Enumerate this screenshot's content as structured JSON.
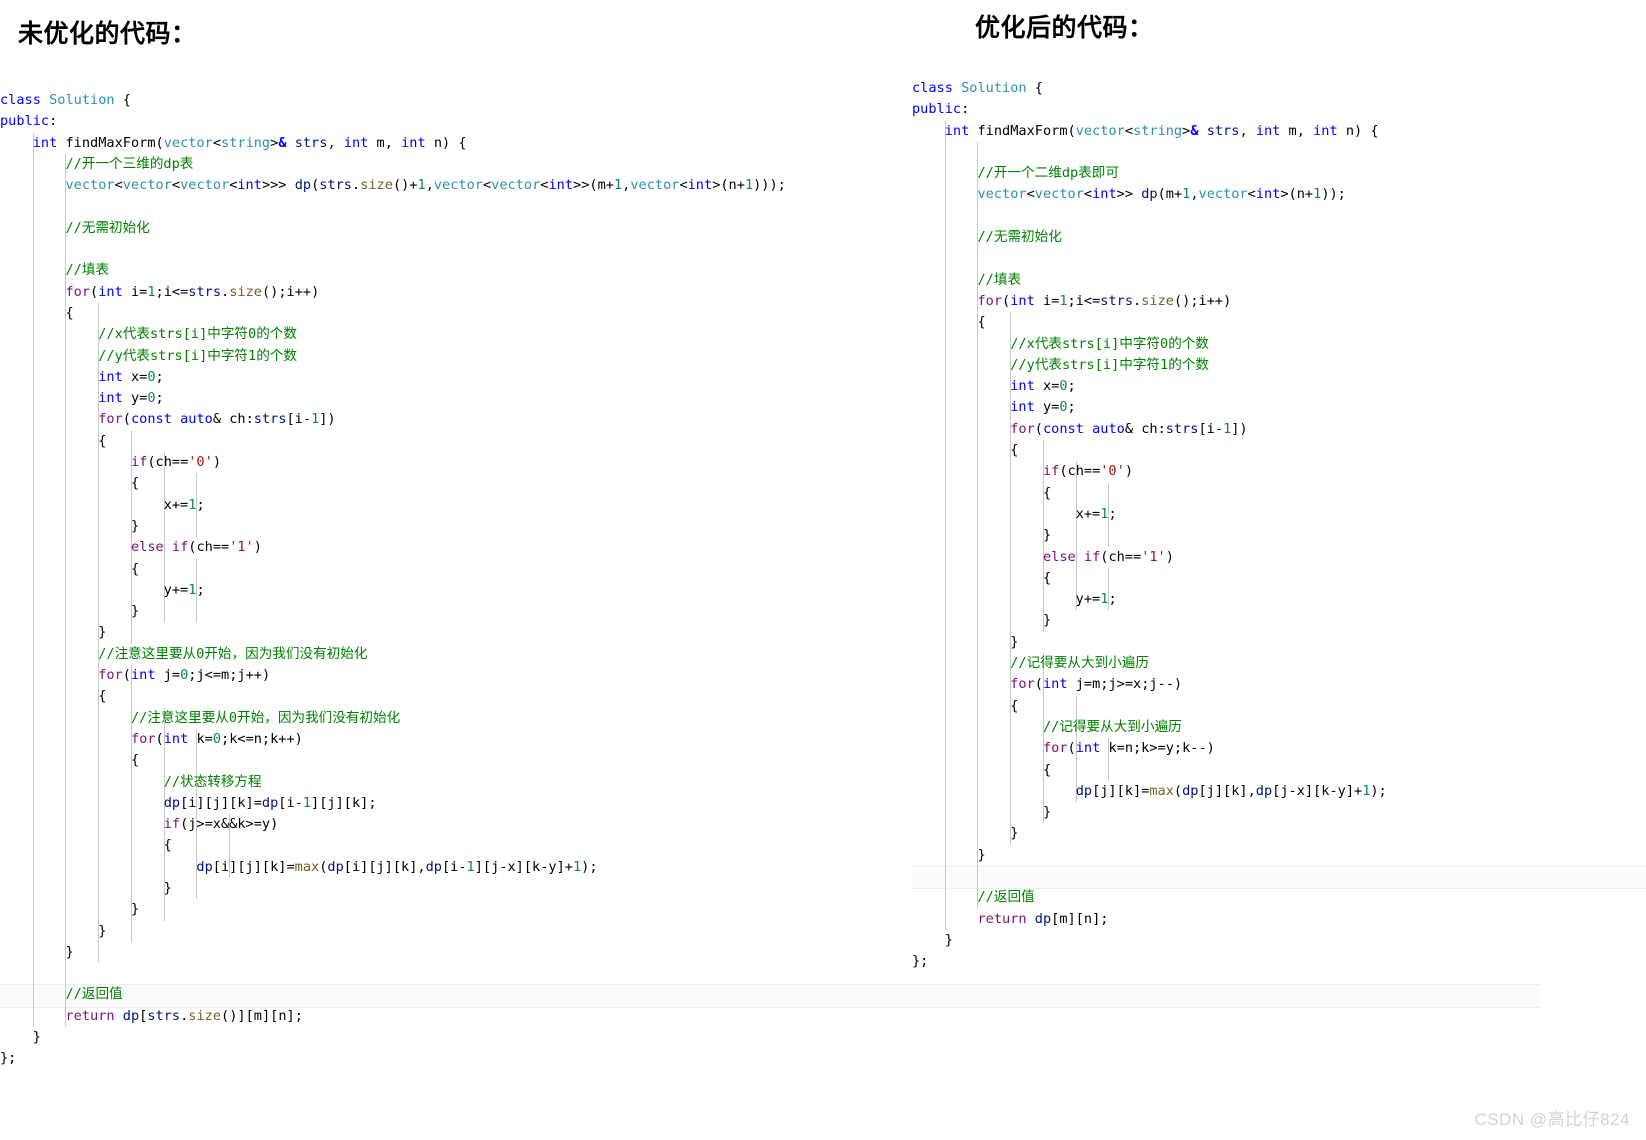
{
  "page": {
    "watermark": "CSDN @高比仔824",
    "background_color": "#ffffff",
    "highlight_band_color": "#fbfbfb"
  },
  "panels": [
    {
      "id": "unoptimized",
      "heading": "未优化的代码：",
      "language": "C++",
      "code_lines": [
        "class Solution {",
        "public:",
        "    int findMaxForm(vector<string>& strs, int m, int n) {",
        "        //开一个三维的dp表",
        "        vector<vector<vector<int>>> dp(strs.size()+1,vector<vector<int>>(m+1,vector<int>(n+1)));",
        "",
        "        //无需初始化",
        "",
        "        //填表",
        "        for(int i=1;i<=strs.size();i++)",
        "        {",
        "            //x代表strs[i]中字符0的个数",
        "            //y代表strs[i]中字符1的个数",
        "            int x=0;",
        "            int y=0;",
        "            for(const auto& ch:strs[i-1])",
        "            {",
        "                if(ch=='0')",
        "                {",
        "                    x+=1;",
        "                }",
        "                else if(ch=='1')",
        "                {",
        "                    y+=1;",
        "                }",
        "            }",
        "            //注意这里要从0开始，因为我们没有初始化",
        "            for(int j=0;j<=m;j++)",
        "            {",
        "                //注意这里要从0开始，因为我们没有初始化",
        "                for(int k=0;k<=n;k++)",
        "                {",
        "                    //状态转移方程",
        "                    dp[i][j][k]=dp[i-1][j][k];",
        "                    if(j>=x&&k>=y)",
        "                    {",
        "                        dp[i][j][k]=max(dp[i][j][k],dp[i-1][j-x][k-y]+1);",
        "                    }",
        "                }",
        "            }",
        "        }",
        "",
        "        //返回值",
        "        return dp[strs.size()][m][n];",
        "    }",
        "};"
      ],
      "highlighted_line_index": 42,
      "highlighted_line_text": "        //返回值"
    },
    {
      "id": "optimized",
      "heading": "优化后的代码：",
      "language": "C++",
      "code_lines": [
        "class Solution {",
        "public:",
        "    int findMaxForm(vector<string>& strs, int m, int n) {",
        "",
        "        //开一个二维dp表即可",
        "        vector<vector<int>> dp(m+1,vector<int>(n+1));",
        "",
        "        //无需初始化",
        "",
        "        //填表",
        "        for(int i=1;i<=strs.size();i++)",
        "        {",
        "            //x代表strs[i]中字符0的个数",
        "            //y代表strs[i]中字符1的个数",
        "            int x=0;",
        "            int y=0;",
        "            for(const auto& ch:strs[i-1])",
        "            {",
        "                if(ch=='0')",
        "                {",
        "                    x+=1;",
        "                }",
        "                else if(ch=='1')",
        "                {",
        "                    y+=1;",
        "                }",
        "            }",
        "            //记得要从大到小遍历",
        "            for(int j=m;j>=x;j--)",
        "            {",
        "                //记得要从大到小遍历",
        "                for(int k=n;k>=y;k--)",
        "                {",
        "                    dp[j][k]=max(dp[j][k],dp[j-x][k-y]+1);",
        "                }",
        "            }",
        "        }",
        "",
        "        //返回值",
        "        return dp[m][n];",
        "    }",
        "};"
      ],
      "highlighted_line_index": 37,
      "highlighted_line_text": "        //返回值"
    }
  ],
  "colors": {
    "comment": "#008000",
    "keyword": "#0000ff",
    "control_keyword": "#7f0e7f",
    "type": "#2b91af",
    "number": "#098658",
    "string": "#a31515",
    "function": "#795e26",
    "variable": "#001080",
    "text": "#000000"
  }
}
